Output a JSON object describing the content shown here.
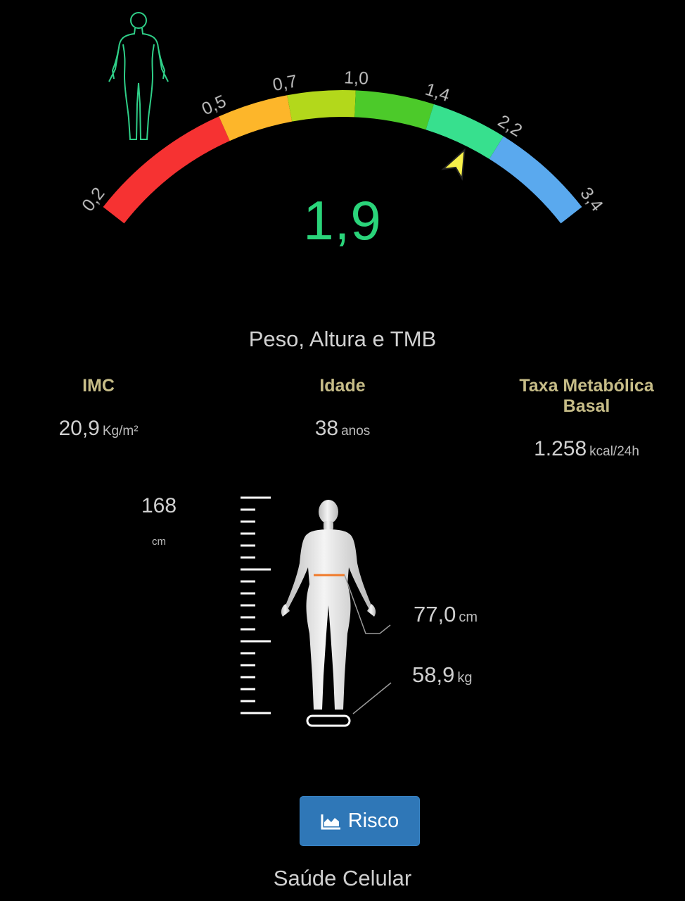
{
  "gauge": {
    "value": "1,9",
    "numeric_value": 1.9,
    "ticks": [
      "0,2",
      "0,5",
      "0,7",
      "1,0",
      "1,4",
      "2,2",
      "3,4"
    ],
    "tick_values": [
      0.2,
      0.5,
      0.7,
      1.0,
      1.4,
      2.2,
      3.4
    ],
    "segment_colors": [
      "#f63232",
      "#fdb62a",
      "#b3d81b",
      "#4cca2a",
      "#37e08e",
      "#5aa9ee"
    ],
    "pointer_color": "#f7f04a",
    "value_color": "#2ad47a",
    "body_icon": "body-outline-icon"
  },
  "section": {
    "title": "Peso, Altura e TMB"
  },
  "stats": {
    "imc": {
      "label": "IMC",
      "value": "20,9",
      "unit": "Kg/m²"
    },
    "idade": {
      "label": "Idade",
      "value": "38",
      "unit": "anos"
    },
    "tmb": {
      "label_line1": "Taxa Metabólica",
      "label_line2": "Basal",
      "value": "1.258",
      "unit": "kcal/24h"
    }
  },
  "body": {
    "height_value": "168",
    "height_unit": "cm",
    "waist_value": "77,0",
    "waist_unit": "cm",
    "weight_value": "58,9",
    "weight_unit": "kg",
    "figure_icon": "human-figure-icon",
    "waist_line_color": "#f07a2a"
  },
  "actions": {
    "risk_label": "Risco",
    "risk_icon": "area-chart-icon"
  },
  "footer": {
    "title": "Saúde Celular"
  }
}
